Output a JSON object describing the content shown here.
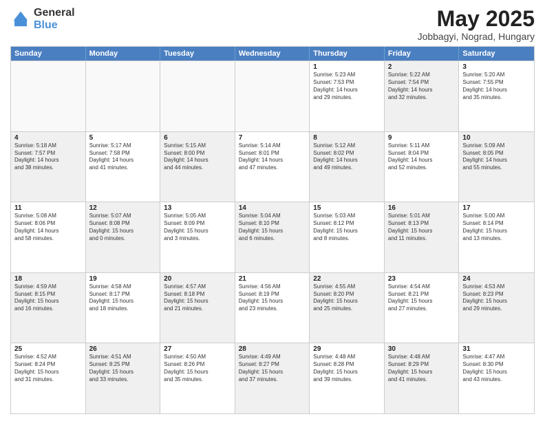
{
  "header": {
    "logo_general": "General",
    "logo_blue": "Blue",
    "month_title": "May 2025",
    "location": "Jobbagyi, Nograd, Hungary"
  },
  "days_of_week": [
    "Sunday",
    "Monday",
    "Tuesday",
    "Wednesday",
    "Thursday",
    "Friday",
    "Saturday"
  ],
  "weeks": [
    [
      {
        "day": "",
        "empty": true,
        "shaded": false,
        "text": ""
      },
      {
        "day": "",
        "empty": true,
        "shaded": false,
        "text": ""
      },
      {
        "day": "",
        "empty": true,
        "shaded": false,
        "text": ""
      },
      {
        "day": "",
        "empty": true,
        "shaded": false,
        "text": ""
      },
      {
        "day": "1",
        "empty": false,
        "shaded": false,
        "text": "Sunrise: 5:23 AM\nSunset: 7:53 PM\nDaylight: 14 hours\nand 29 minutes."
      },
      {
        "day": "2",
        "empty": false,
        "shaded": true,
        "text": "Sunrise: 5:22 AM\nSunset: 7:54 PM\nDaylight: 14 hours\nand 32 minutes."
      },
      {
        "day": "3",
        "empty": false,
        "shaded": false,
        "text": "Sunrise: 5:20 AM\nSunset: 7:55 PM\nDaylight: 14 hours\nand 35 minutes."
      }
    ],
    [
      {
        "day": "4",
        "empty": false,
        "shaded": true,
        "text": "Sunrise: 5:18 AM\nSunset: 7:57 PM\nDaylight: 14 hours\nand 38 minutes."
      },
      {
        "day": "5",
        "empty": false,
        "shaded": false,
        "text": "Sunrise: 5:17 AM\nSunset: 7:58 PM\nDaylight: 14 hours\nand 41 minutes."
      },
      {
        "day": "6",
        "empty": false,
        "shaded": true,
        "text": "Sunrise: 5:15 AM\nSunset: 8:00 PM\nDaylight: 14 hours\nand 44 minutes."
      },
      {
        "day": "7",
        "empty": false,
        "shaded": false,
        "text": "Sunrise: 5:14 AM\nSunset: 8:01 PM\nDaylight: 14 hours\nand 47 minutes."
      },
      {
        "day": "8",
        "empty": false,
        "shaded": true,
        "text": "Sunrise: 5:12 AM\nSunset: 8:02 PM\nDaylight: 14 hours\nand 49 minutes."
      },
      {
        "day": "9",
        "empty": false,
        "shaded": false,
        "text": "Sunrise: 5:11 AM\nSunset: 8:04 PM\nDaylight: 14 hours\nand 52 minutes."
      },
      {
        "day": "10",
        "empty": false,
        "shaded": true,
        "text": "Sunrise: 5:09 AM\nSunset: 8:05 PM\nDaylight: 14 hours\nand 55 minutes."
      }
    ],
    [
      {
        "day": "11",
        "empty": false,
        "shaded": false,
        "text": "Sunrise: 5:08 AM\nSunset: 8:06 PM\nDaylight: 14 hours\nand 58 minutes."
      },
      {
        "day": "12",
        "empty": false,
        "shaded": true,
        "text": "Sunrise: 5:07 AM\nSunset: 8:08 PM\nDaylight: 15 hours\nand 0 minutes."
      },
      {
        "day": "13",
        "empty": false,
        "shaded": false,
        "text": "Sunrise: 5:05 AM\nSunset: 8:09 PM\nDaylight: 15 hours\nand 3 minutes."
      },
      {
        "day": "14",
        "empty": false,
        "shaded": true,
        "text": "Sunrise: 5:04 AM\nSunset: 8:10 PM\nDaylight: 15 hours\nand 6 minutes."
      },
      {
        "day": "15",
        "empty": false,
        "shaded": false,
        "text": "Sunrise: 5:03 AM\nSunset: 8:12 PM\nDaylight: 15 hours\nand 8 minutes."
      },
      {
        "day": "16",
        "empty": false,
        "shaded": true,
        "text": "Sunrise: 5:01 AM\nSunset: 8:13 PM\nDaylight: 15 hours\nand 11 minutes."
      },
      {
        "day": "17",
        "empty": false,
        "shaded": false,
        "text": "Sunrise: 5:00 AM\nSunset: 8:14 PM\nDaylight: 15 hours\nand 13 minutes."
      }
    ],
    [
      {
        "day": "18",
        "empty": false,
        "shaded": true,
        "text": "Sunrise: 4:59 AM\nSunset: 8:15 PM\nDaylight: 15 hours\nand 16 minutes."
      },
      {
        "day": "19",
        "empty": false,
        "shaded": false,
        "text": "Sunrise: 4:58 AM\nSunset: 8:17 PM\nDaylight: 15 hours\nand 18 minutes."
      },
      {
        "day": "20",
        "empty": false,
        "shaded": true,
        "text": "Sunrise: 4:57 AM\nSunset: 8:18 PM\nDaylight: 15 hours\nand 21 minutes."
      },
      {
        "day": "21",
        "empty": false,
        "shaded": false,
        "text": "Sunrise: 4:56 AM\nSunset: 8:19 PM\nDaylight: 15 hours\nand 23 minutes."
      },
      {
        "day": "22",
        "empty": false,
        "shaded": true,
        "text": "Sunrise: 4:55 AM\nSunset: 8:20 PM\nDaylight: 15 hours\nand 25 minutes."
      },
      {
        "day": "23",
        "empty": false,
        "shaded": false,
        "text": "Sunrise: 4:54 AM\nSunset: 8:21 PM\nDaylight: 15 hours\nand 27 minutes."
      },
      {
        "day": "24",
        "empty": false,
        "shaded": true,
        "text": "Sunrise: 4:53 AM\nSunset: 8:23 PM\nDaylight: 15 hours\nand 29 minutes."
      }
    ],
    [
      {
        "day": "25",
        "empty": false,
        "shaded": false,
        "text": "Sunrise: 4:52 AM\nSunset: 8:24 PM\nDaylight: 15 hours\nand 31 minutes."
      },
      {
        "day": "26",
        "empty": false,
        "shaded": true,
        "text": "Sunrise: 4:51 AM\nSunset: 8:25 PM\nDaylight: 15 hours\nand 33 minutes."
      },
      {
        "day": "27",
        "empty": false,
        "shaded": false,
        "text": "Sunrise: 4:50 AM\nSunset: 8:26 PM\nDaylight: 15 hours\nand 35 minutes."
      },
      {
        "day": "28",
        "empty": false,
        "shaded": true,
        "text": "Sunrise: 4:49 AM\nSunset: 8:27 PM\nDaylight: 15 hours\nand 37 minutes."
      },
      {
        "day": "29",
        "empty": false,
        "shaded": false,
        "text": "Sunrise: 4:48 AM\nSunset: 8:28 PM\nDaylight: 15 hours\nand 39 minutes."
      },
      {
        "day": "30",
        "empty": false,
        "shaded": true,
        "text": "Sunrise: 4:48 AM\nSunset: 8:29 PM\nDaylight: 15 hours\nand 41 minutes."
      },
      {
        "day": "31",
        "empty": false,
        "shaded": false,
        "text": "Sunrise: 4:47 AM\nSunset: 8:30 PM\nDaylight: 15 hours\nand 43 minutes."
      }
    ]
  ]
}
